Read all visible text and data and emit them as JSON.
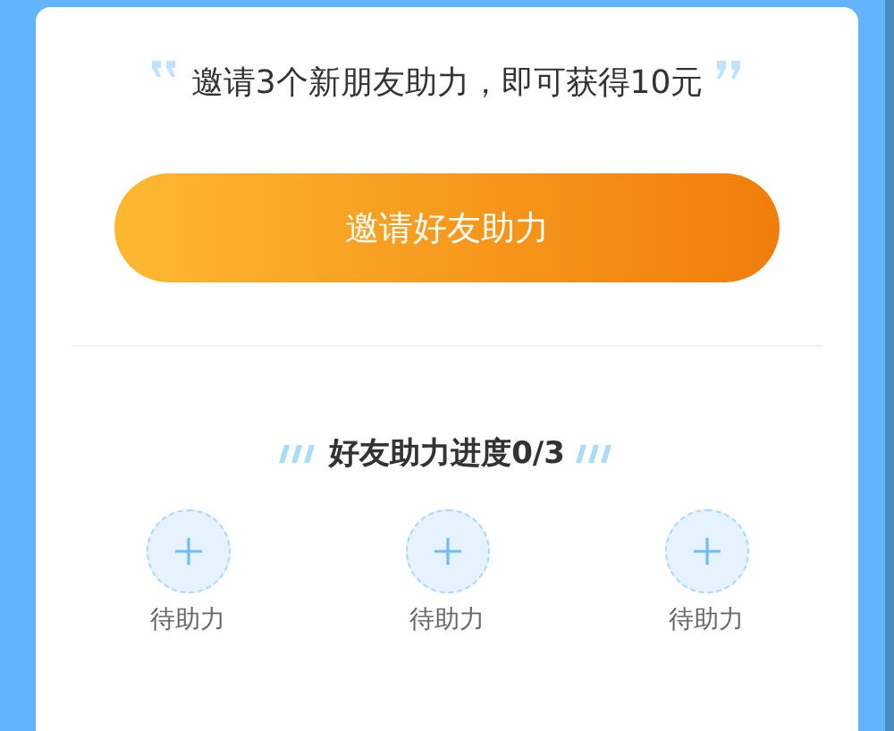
{
  "invite": {
    "message": "邀请3个新朋友助力，即可获得10元",
    "button": "邀请好友助力"
  },
  "progress": {
    "title": "好友助力进度0/3",
    "slots": [
      {
        "label": "待助力"
      },
      {
        "label": "待助力"
      },
      {
        "label": "待助力"
      }
    ]
  }
}
